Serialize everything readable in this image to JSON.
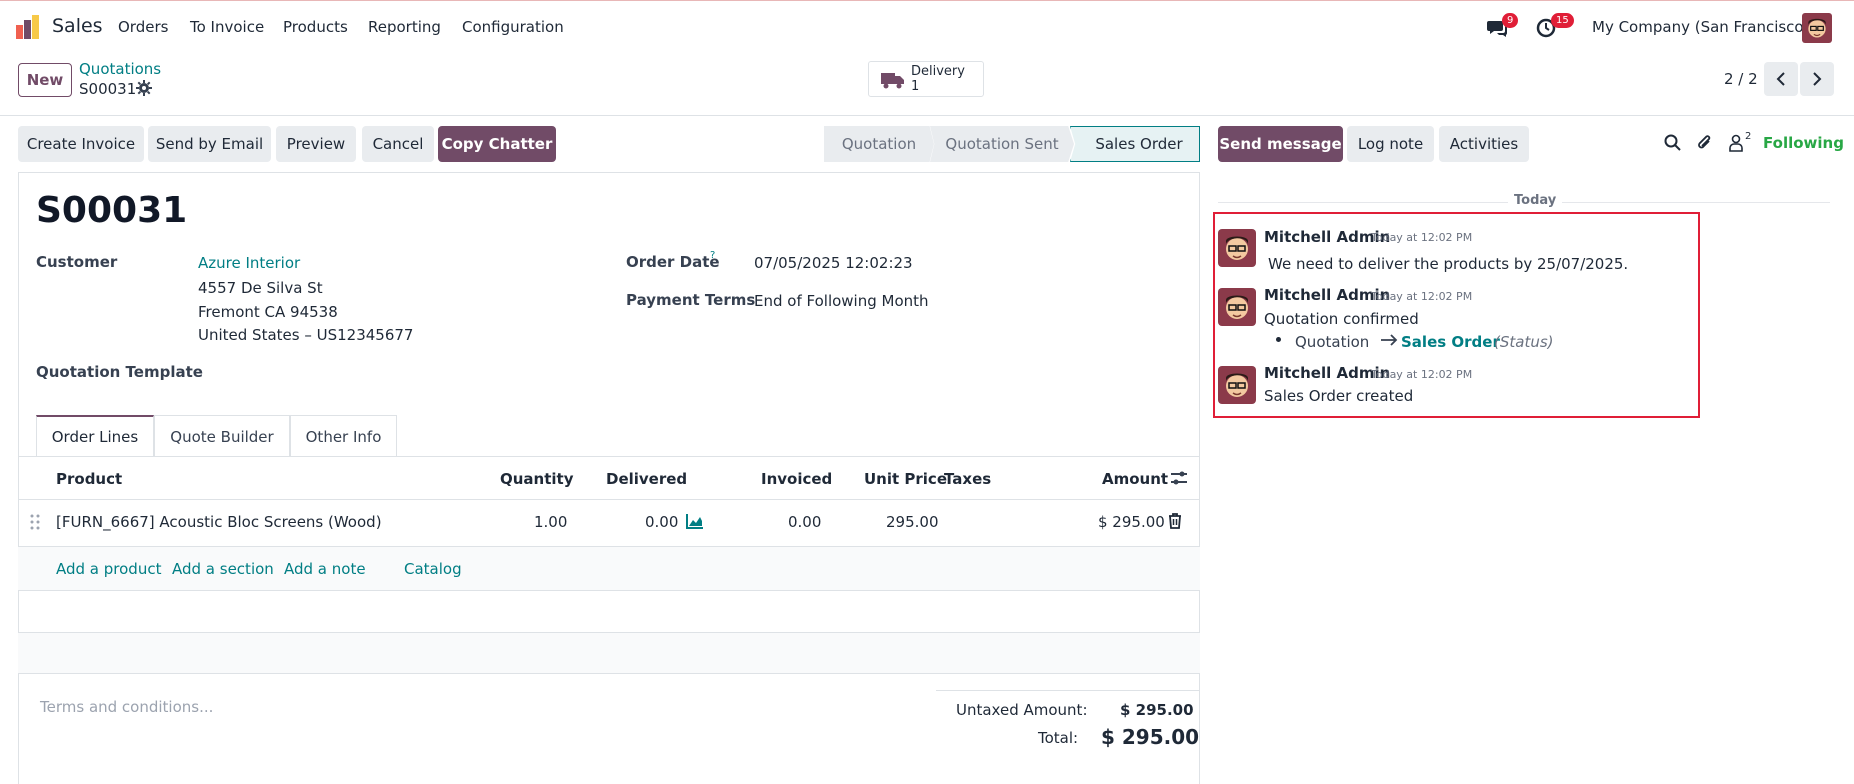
{
  "navbar": {
    "app_name": "Sales",
    "menus": [
      "Orders",
      "To Invoice",
      "Products",
      "Reporting",
      "Configuration"
    ],
    "messages_count": "9",
    "activities_count": "15",
    "company": "My Company (San Francisco)"
  },
  "control_panel": {
    "new_label": "New",
    "breadcrumb_parent": "Quotations",
    "record_name": "S00031",
    "smart_button": {
      "label": "Delivery",
      "count": "1"
    },
    "pager": "2 / 2"
  },
  "actions": {
    "create_invoice": "Create Invoice",
    "send_by_email": "Send by Email",
    "preview": "Preview",
    "cancel": "Cancel",
    "copy_chatter": "Copy Chatter"
  },
  "status_stages": [
    "Quotation",
    "Quotation Sent",
    "Sales Order"
  ],
  "form": {
    "title": "S00031",
    "customer_label": "Customer",
    "customer_name": "Azure Interior",
    "address_line1": "4557 De Silva St",
    "address_line2": "Fremont CA 94538",
    "address_line3": "United States – US12345677",
    "template_label": "Quotation Template",
    "order_date_label": "Order Date",
    "order_date_help": "?",
    "order_date": "07/05/2025 12:02:23",
    "payment_terms_label": "Payment Terms",
    "payment_terms": "End of Following Month"
  },
  "tabs": [
    "Order Lines",
    "Quote Builder",
    "Other Info"
  ],
  "order_lines": {
    "headers": {
      "product": "Product",
      "quantity": "Quantity",
      "delivered": "Delivered",
      "invoiced": "Invoiced",
      "unit_price": "Unit Price",
      "taxes": "Taxes",
      "amount": "Amount"
    },
    "rows": [
      {
        "product": "[FURN_6667] Acoustic Bloc Screens (Wood)",
        "quantity": "1.00",
        "delivered": "0.00",
        "invoiced": "0.00",
        "unit_price": "295.00",
        "taxes": "",
        "amount": "$ 295.00"
      }
    ],
    "add_product": "Add a product",
    "add_section": "Add a section",
    "add_note": "Add a note",
    "catalog": "Catalog"
  },
  "terms_placeholder": "Terms and conditions...",
  "totals": {
    "untaxed_label": "Untaxed Amount:",
    "untaxed_value": "$ 295.00",
    "total_label": "Total:",
    "total_value": "$ 295.00"
  },
  "chatter": {
    "send_message": "Send message",
    "log_note": "Log note",
    "activities": "Activities",
    "followers_count": "2",
    "following": "Following",
    "date_separator": "Today",
    "messages": [
      {
        "author": "Mitchell Admin",
        "time": "Today at 12:02 PM",
        "body": "We need to deliver the products by 25/07/2025."
      },
      {
        "author": "Mitchell Admin",
        "time": "Today at 12:02 PM",
        "body": "Quotation confirmed",
        "tracking": {
          "old": "Quotation",
          "new": "Sales Order",
          "field": "(Status)"
        }
      },
      {
        "author": "Mitchell Admin",
        "time": "Today at 12:02 PM",
        "body": "Sales Order created"
      }
    ]
  },
  "colors": {
    "primary": "#714b67",
    "link": "#017e84",
    "highlight_box": "#e01e37",
    "following": "#28a745"
  }
}
